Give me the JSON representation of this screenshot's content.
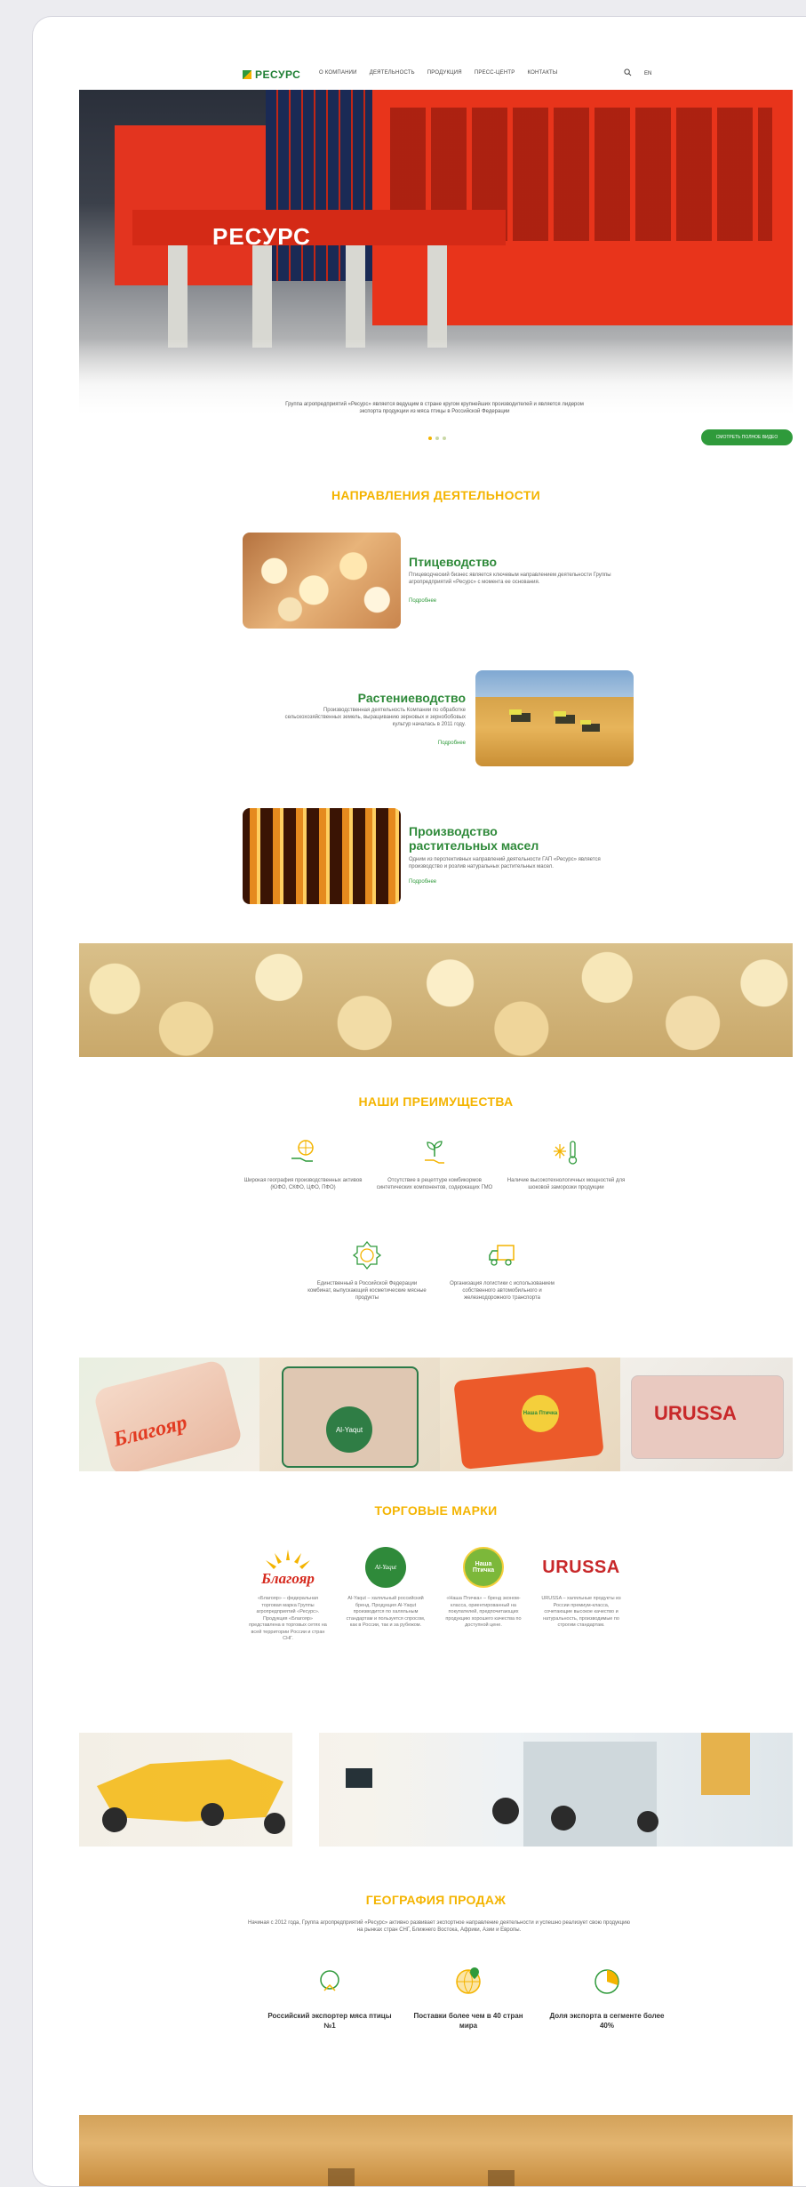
{
  "header": {
    "logo_text": "РЕСУРС",
    "nav": [
      "О компании",
      "Деятельность",
      "Продукция",
      "Пресс-центр",
      "Контакты"
    ],
    "lang": "EN"
  },
  "hero": {
    "sign": "РЕСУРС",
    "caption": "Группа агропредприятий «Ресурс» является ведущим в стране кругом крупнейших производителей и является лидером экспорта продукции из мяса птицы в Российской Федерации",
    "button": "Смотреть полное видео",
    "slides": 3,
    "active_slide": 1
  },
  "directions": {
    "title": "Направления деятельности",
    "items": [
      {
        "title": "Птицеводство",
        "desc": "Птицеводческий бизнес является ключевым направлением деятельности Группы агропредприятий «Ресурс» с момента ее основания.",
        "more": "Подробнее"
      },
      {
        "title": "Растениеводство",
        "desc": "Производственная деятельность Компании по обработке сельскохозяйственных земель, выращиванию зерновых и зернобобовых культур началась в 2011 году.",
        "more": "Подробнее"
      },
      {
        "title": "Производство растительных масел",
        "desc": "Одним из перспективных направлений деятельности ГАП «Ресурс» является производство и розлив натуральных растительных масел.",
        "more": "Подробнее"
      }
    ]
  },
  "advantages": {
    "title": "Наши преимущества",
    "items": [
      "Широкая география производственных активов (ЮФО, СКФО, ЦФО, ПФО)",
      "Отсутствие в рецептуре комбикормов синтетических компонентов, содержащих ГМО",
      "Наличие высокотехнологичных мощностей для шоковой заморозки продукции",
      "Единственный в Российской Федерации комбинат, выпускающий косметические мясные продукты",
      "Организация логистики с использованием собственного автомобильного и железнодорожного транспорта"
    ]
  },
  "brands": {
    "title": "Торговые марки",
    "items": [
      {
        "name": "Благояр",
        "desc": "«Благояр» – федеральная торговая марка Группы агропредприятий «Ресурс». Продукция «Благояр» представлена в торговых сетях на всей территории России и стран СНГ."
      },
      {
        "name": "Al-Yaqut",
        "desc": "Al-Yaqut – халяльный российский бренд. Продукция Al-Yaqut производится по халяльным стандартам и пользуется спросом, как в России, так и за рубежом."
      },
      {
        "name": "Наша Птичка",
        "desc": "«Наша Птичка» – бренд эконом-класса, ориентированный на покупателей, предпочитающих продукцию хорошего качества по доступной цене."
      },
      {
        "name": "URUSSA",
        "desc": "URUSSA – халяльные продукты из России премиум-класса, сочетающие высокое качество и натуральность, производимые по строгим стандартам."
      }
    ],
    "product_labels": [
      "Благояр",
      "Al-Yaqut",
      "Наша Птичка",
      "URUSSA"
    ]
  },
  "geography": {
    "title": "География продаж",
    "text": "Начиная с 2012 года, Группа агропредприятий «Ресурс» активно развивает экспортное направление деятельности и успешно реализует свою продукцию на рынках стран СНГ, Ближнего Востока, Африки, Азии и Европы.",
    "stats": [
      "Российский экспортер мяса птицы №1",
      "Поставки более чем в 40 стран мира",
      "Доля экспорта в сегменте более 40%"
    ]
  },
  "colors": {
    "brand_green": "#2f9a3b",
    "accent_yellow": "#f4b400",
    "red": "#e23b22"
  }
}
